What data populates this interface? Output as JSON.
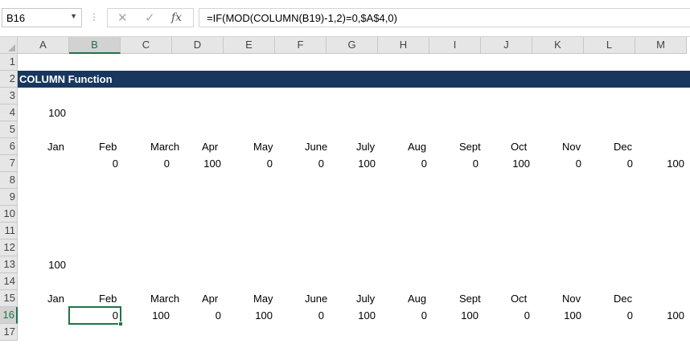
{
  "formula_bar": {
    "name_box": "B16",
    "formula": "=IF(MOD(COLUMN(B19)-1,2)=0,$A$4,0)",
    "cancel_icon": "x-icon",
    "enter_icon": "check-icon",
    "function_icon": "fx-icon"
  },
  "columns": [
    "A",
    "B",
    "C",
    "D",
    "E",
    "F",
    "G",
    "H",
    "I",
    "J",
    "K",
    "L",
    "M"
  ],
  "active_column": "B",
  "rows": [
    "1",
    "2",
    "3",
    "4",
    "5",
    "6",
    "7",
    "8",
    "9",
    "10",
    "11",
    "12",
    "13",
    "14",
    "15",
    "16",
    "17"
  ],
  "active_row": "16",
  "sheet": {
    "title": "COLUMN Function",
    "first_block": {
      "input_value": "100",
      "months": [
        "Jan",
        "Feb",
        "March",
        "Apr",
        "May",
        "June",
        "July",
        "Aug",
        "Sept",
        "Oct",
        "Nov",
        "Dec"
      ],
      "results": [
        "0",
        "0",
        "100",
        "0",
        "0",
        "100",
        "0",
        "0",
        "100",
        "0",
        "0",
        "100"
      ]
    },
    "second_block": {
      "input_value": "100",
      "months": [
        "Jan",
        "Feb",
        "March",
        "Apr",
        "May",
        "June",
        "July",
        "Aug",
        "Sept",
        "Oct",
        "Nov",
        "Dec"
      ],
      "results": [
        "0",
        "100",
        "0",
        "100",
        "0",
        "100",
        "0",
        "100",
        "0",
        "100",
        "0",
        "100"
      ]
    }
  },
  "colors": {
    "title_fill": "#17375e",
    "selection_border": "#217346",
    "header_fill": "#e6e6e6"
  }
}
